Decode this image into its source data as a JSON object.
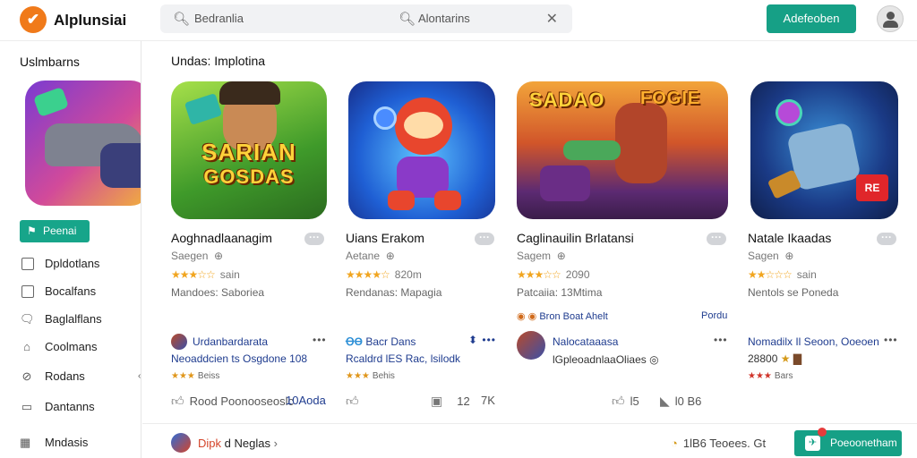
{
  "header": {
    "app_title": "Alplunsiai",
    "logo_glyph": "✔",
    "search_left": "Bedranlia",
    "search_right": "Alontarins",
    "primary_button": "Adefeoben"
  },
  "sidebar": {
    "title": "Uslmbarns",
    "button": "Peenai",
    "items": [
      {
        "label": "Dpldotlans",
        "icon": "checkbox-icon"
      },
      {
        "label": "Bocalfans",
        "icon": "checkbox-icon"
      },
      {
        "label": "Baglalflans",
        "icon": "chat-icon"
      },
      {
        "label": "Coolmans",
        "icon": "home-icon"
      },
      {
        "label": "Rodans",
        "icon": "tag-icon"
      },
      {
        "label": "Dantanns",
        "icon": "document-icon"
      },
      {
        "label": "Mndasis",
        "icon": "grid-icon"
      }
    ]
  },
  "main": {
    "section_title": "Undas: Implotina",
    "cards": [
      {
        "name": "Aoghnadlaanagim",
        "sub": "Saegen",
        "stars": "★★★☆☆",
        "rating": "sain",
        "meta": "Mandoes: Saboriea",
        "author": "Urdanbardarata",
        "author_line": "Neoaddcien ts Osgdone 108",
        "small_rating": "Beiss",
        "thumb_caption_1": "SARIAN",
        "thumb_caption_2": "GOSDAS",
        "action_left": "Rood Poonooseoslc",
        "action_right": "10Aoda"
      },
      {
        "name": "Uians Erakom",
        "sub": "Aetane",
        "stars": "★★★★☆",
        "rating": "820m",
        "meta": "Rendanas: Mapagia",
        "author": "Bacr Dans",
        "author_line": "Rcaldrd lES Rac, lsilodk",
        "small_rating": "Behis",
        "action_left": "12",
        "action_right": "7K"
      },
      {
        "name": "Caglinauilin Brlatansi",
        "sub": "Sagem",
        "stars": "★★★☆☆",
        "rating": "2090",
        "meta": "Patcaiia: 13Mtima",
        "strip_left": "Bron Boat Ahelt",
        "strip_right": "Pordu",
        "author": "Nalocataaasa",
        "author_line": "lGpleoadnlaaOliaes",
        "caption_left": "SADAO",
        "caption_right": "FOGIE",
        "action_left": "l5",
        "action_right": "l0 B6"
      },
      {
        "name": "Natale Ikaadas",
        "sub": "Sagen",
        "stars": "★★☆☆☆",
        "rating": "sain",
        "meta": "Nentols se Poneda",
        "author": "Nomadilx Il Seoon, Ooeoen",
        "author_line": "28800",
        "small_rating": "Bars",
        "badge": "RE"
      }
    ]
  },
  "footer": {
    "text_highlight": "Dipk",
    "text_rest": "d Neglas",
    "stat": "1lB6 Teoees. Gt",
    "button": "Poeoonetham"
  },
  "colors": {
    "accent": "#16a086",
    "logo": "#f07a1a",
    "star": "#f1a51f",
    "link": "#1f3c8f"
  }
}
